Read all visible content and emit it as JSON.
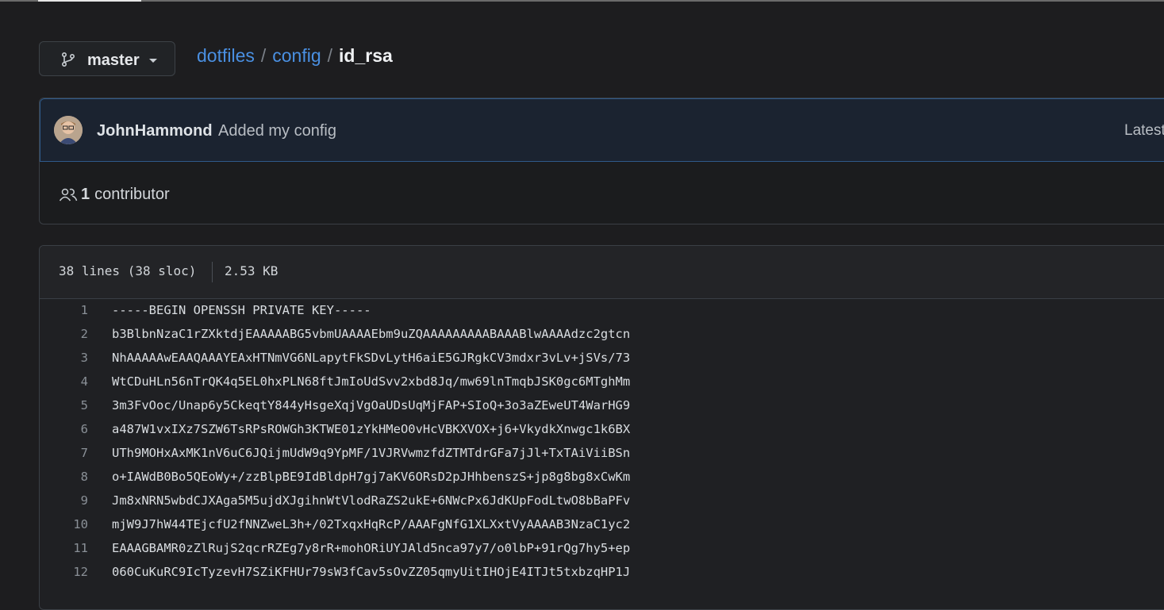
{
  "branch": {
    "name": "master",
    "icon": "git-branch-icon"
  },
  "breadcrumb": {
    "repo": "dotfiles",
    "folder": "config",
    "file": "id_rsa",
    "separator": "/"
  },
  "commit": {
    "author": "JohnHammond",
    "message": "Added my config",
    "latest_label": "Latest"
  },
  "contributors": {
    "count": "1",
    "label": "contributor",
    "icon": "people-icon"
  },
  "file_info": {
    "lines": "38 lines (38 sloc)",
    "size": "2.53 KB"
  },
  "code_lines": [
    {
      "num": "1",
      "text": "-----BEGIN OPENSSH PRIVATE KEY-----"
    },
    {
      "num": "2",
      "text": "b3BlbnNzaC1rZXktdjEAAAAABG5vbmUAAAAEbm9uZQAAAAAAAAABAAABlwAAAAdzc2gtcn"
    },
    {
      "num": "3",
      "text": "NhAAAAAwEAAQAAAYEAxHTNmVG6NLapytFkSDvLytH6aiE5GJRgkCV3mdxr3vLv+jSVs/73"
    },
    {
      "num": "4",
      "text": "WtCDuHLn56nTrQK4q5EL0hxPLN68ftJmIoUdSvv2xbd8Jq/mw69lnTmqbJSK0gc6MTghMm"
    },
    {
      "num": "5",
      "text": "3m3FvOoc/Unap6y5CkeqtY844yHsgeXqjVgOaUDsUqMjFAP+SIoQ+3o3aZEweUT4WarHG9"
    },
    {
      "num": "6",
      "text": "a487W1vxIXz7SZW6TsRPsROWGh3KTWE01zYkHMeO0vHcVBKXVOX+j6+VkydkXnwgc1k6BX"
    },
    {
      "num": "7",
      "text": "UTh9MOHxAxMK1nV6uC6JQijmUdW9q9YpMF/1VJRVwmzfdZTMTdrGFa7jJl+TxTAiViiBSn"
    },
    {
      "num": "8",
      "text": "o+IAWdB0Bo5QEoWy+/zzBlpBE9IdBldpH7gj7aKV6ORsD2pJHhbenszS+jp8g8bg8xCwKm"
    },
    {
      "num": "9",
      "text": "Jm8xNRN5wbdCJXAga5M5ujdXJgihnWtVlodRaZS2ukE+6NWcPx6JdKUpFodLtwO8bBaPFv"
    },
    {
      "num": "10",
      "text": "mjW9J7hW44TEjcfU2fNNZweL3h+/02TxqxHqRcP/AAAFgNfG1XLXxtVyAAAAB3NzaC1yc2"
    },
    {
      "num": "11",
      "text": "EAAAGBAMR0zZlRujS2qcrRZEg7y8rR+mohORiUYJAld5nca97y7/o0lbP+91rQg7hy5+ep"
    },
    {
      "num": "12",
      "text": "060CuKuRC9IcTyzevH7SZiKFHUr79sW3fCav5sOvZZ05qmyUitIHOjE4ITJt5txbzqHP1J"
    }
  ]
}
